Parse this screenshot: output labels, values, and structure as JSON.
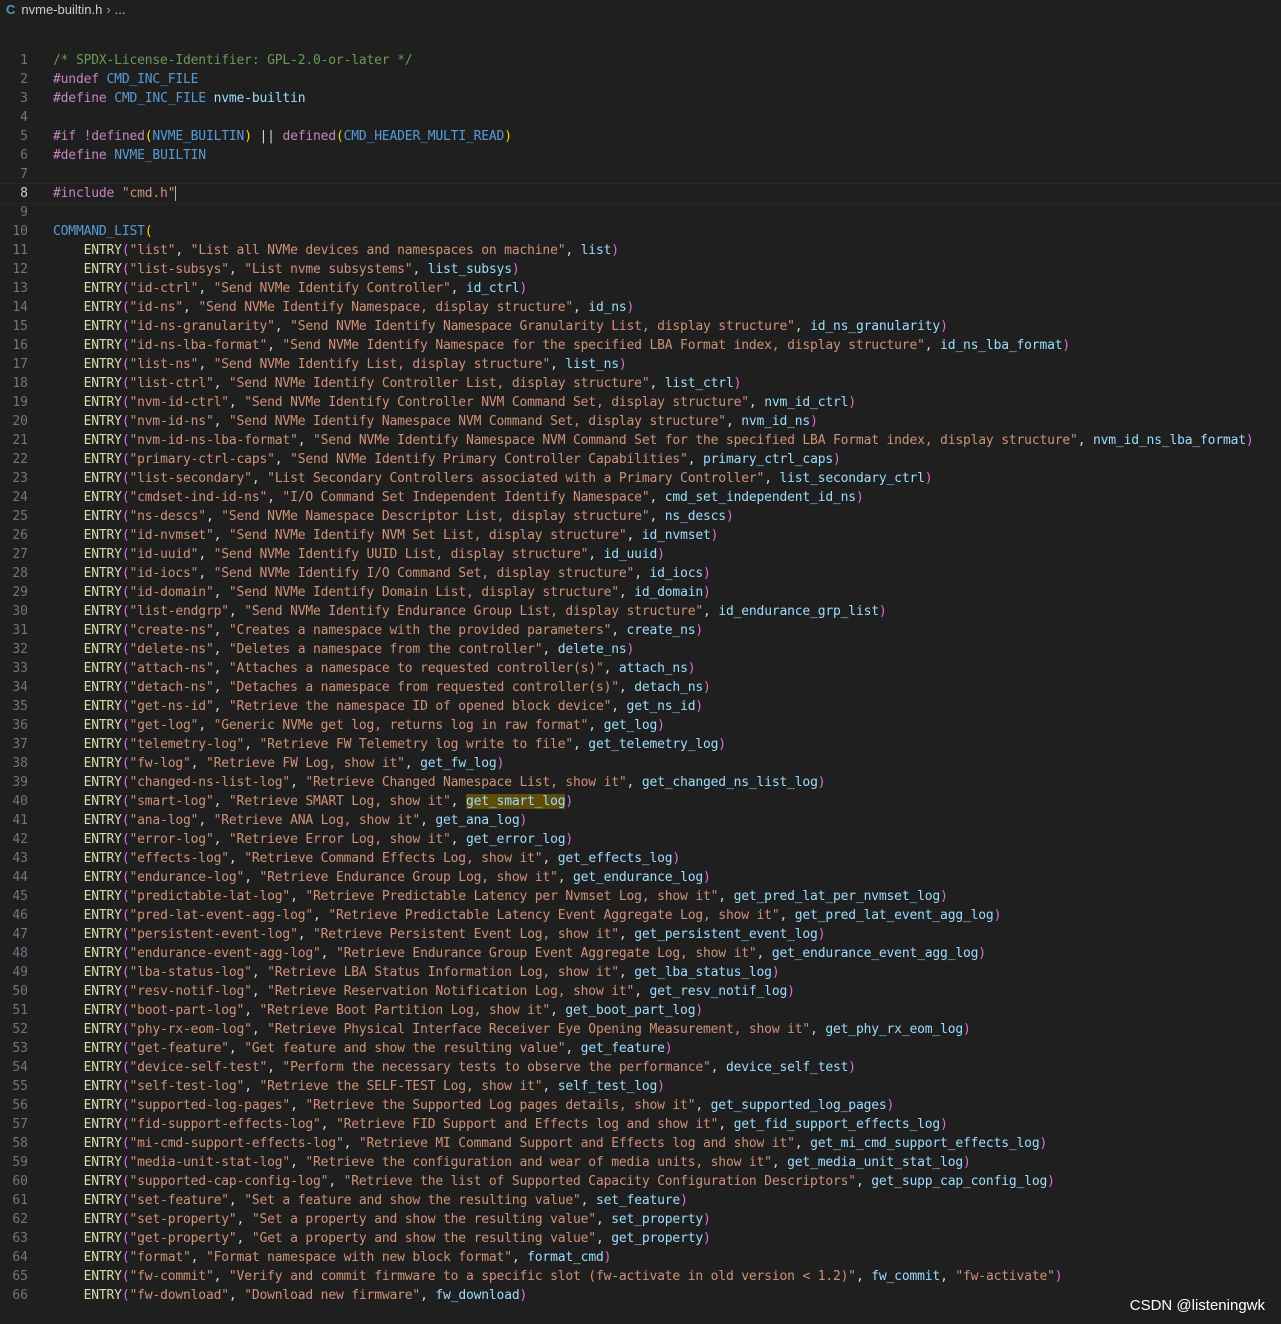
{
  "breadcrumb": {
    "file": "nvme-builtin.h",
    "more": "..."
  },
  "editor": {
    "current_line": 8,
    "highlight_line": 40,
    "highlight_word": "get_smart_log",
    "header": [
      "/* SPDX-License-Identifier: GPL-2.0-or-later */",
      "#undef CMD_INC_FILE",
      "#define CMD_INC_FILE nvme-builtin",
      "",
      "#if !defined(NVME_BUILTIN) || defined(CMD_HEADER_MULTI_READ)",
      "#define NVME_BUILTIN",
      "",
      "#include \"cmd.h\"",
      "",
      "COMMAND_LIST("
    ],
    "entries": [
      [
        "list",
        "List all NVMe devices and namespaces on machine",
        "list"
      ],
      [
        "list-subsys",
        "List nvme subsystems",
        "list_subsys"
      ],
      [
        "id-ctrl",
        "Send NVMe Identify Controller",
        "id_ctrl"
      ],
      [
        "id-ns",
        "Send NVMe Identify Namespace, display structure",
        "id_ns"
      ],
      [
        "id-ns-granularity",
        "Send NVMe Identify Namespace Granularity List, display structure",
        "id_ns_granularity"
      ],
      [
        "id-ns-lba-format",
        "Send NVMe Identify Namespace for the specified LBA Format index, display structure",
        "id_ns_lba_format"
      ],
      [
        "list-ns",
        "Send NVMe Identify List, display structure",
        "list_ns"
      ],
      [
        "list-ctrl",
        "Send NVMe Identify Controller List, display structure",
        "list_ctrl"
      ],
      [
        "nvm-id-ctrl",
        "Send NVMe Identify Controller NVM Command Set, display structure",
        "nvm_id_ctrl"
      ],
      [
        "nvm-id-ns",
        "Send NVMe Identify Namespace NVM Command Set, display structure",
        "nvm_id_ns"
      ],
      [
        "nvm-id-ns-lba-format",
        "Send NVMe Identify Namespace NVM Command Set for the specified LBA Format index, display structure",
        "nvm_id_ns_lba_format"
      ],
      [
        "primary-ctrl-caps",
        "Send NVMe Identify Primary Controller Capabilities",
        "primary_ctrl_caps"
      ],
      [
        "list-secondary",
        "List Secondary Controllers associated with a Primary Controller",
        "list_secondary_ctrl"
      ],
      [
        "cmdset-ind-id-ns",
        "I/O Command Set Independent Identify Namespace",
        "cmd_set_independent_id_ns"
      ],
      [
        "ns-descs",
        "Send NVMe Namespace Descriptor List, display structure",
        "ns_descs"
      ],
      [
        "id-nvmset",
        "Send NVMe Identify NVM Set List, display structure",
        "id_nvmset"
      ],
      [
        "id-uuid",
        "Send NVMe Identify UUID List, display structure",
        "id_uuid"
      ],
      [
        "id-iocs",
        "Send NVMe Identify I/O Command Set, display structure",
        "id_iocs"
      ],
      [
        "id-domain",
        "Send NVMe Identify Domain List, display structure",
        "id_domain"
      ],
      [
        "list-endgrp",
        "Send NVMe Identify Endurance Group List, display structure",
        "id_endurance_grp_list"
      ],
      [
        "create-ns",
        "Creates a namespace with the provided parameters",
        "create_ns"
      ],
      [
        "delete-ns",
        "Deletes a namespace from the controller",
        "delete_ns"
      ],
      [
        "attach-ns",
        "Attaches a namespace to requested controller(s)",
        "attach_ns"
      ],
      [
        "detach-ns",
        "Detaches a namespace from requested controller(s)",
        "detach_ns"
      ],
      [
        "get-ns-id",
        "Retrieve the namespace ID of opened block device",
        "get_ns_id"
      ],
      [
        "get-log",
        "Generic NVMe get log, returns log in raw format",
        "get_log"
      ],
      [
        "telemetry-log",
        "Retrieve FW Telemetry log write to file",
        "get_telemetry_log"
      ],
      [
        "fw-log",
        "Retrieve FW Log, show it",
        "get_fw_log"
      ],
      [
        "changed-ns-list-log",
        "Retrieve Changed Namespace List, show it",
        "get_changed_ns_list_log"
      ],
      [
        "smart-log",
        "Retrieve SMART Log, show it",
        "get_smart_log"
      ],
      [
        "ana-log",
        "Retrieve ANA Log, show it",
        "get_ana_log"
      ],
      [
        "error-log",
        "Retrieve Error Log, show it",
        "get_error_log"
      ],
      [
        "effects-log",
        "Retrieve Command Effects Log, show it",
        "get_effects_log"
      ],
      [
        "endurance-log",
        "Retrieve Endurance Group Log, show it",
        "get_endurance_log"
      ],
      [
        "predictable-lat-log",
        "Retrieve Predictable Latency per Nvmset Log, show it",
        "get_pred_lat_per_nvmset_log"
      ],
      [
        "pred-lat-event-agg-log",
        "Retrieve Predictable Latency Event Aggregate Log, show it",
        "get_pred_lat_event_agg_log"
      ],
      [
        "persistent-event-log",
        "Retrieve Persistent Event Log, show it",
        "get_persistent_event_log"
      ],
      [
        "endurance-event-agg-log",
        "Retrieve Endurance Group Event Aggregate Log, show it",
        "get_endurance_event_agg_log"
      ],
      [
        "lba-status-log",
        "Retrieve LBA Status Information Log, show it",
        "get_lba_status_log"
      ],
      [
        "resv-notif-log",
        "Retrieve Reservation Notification Log, show it",
        "get_resv_notif_log"
      ],
      [
        "boot-part-log",
        "Retrieve Boot Partition Log, show it",
        "get_boot_part_log"
      ],
      [
        "phy-rx-eom-log",
        "Retrieve Physical Interface Receiver Eye Opening Measurement, show it",
        "get_phy_rx_eom_log"
      ],
      [
        "get-feature",
        "Get feature and show the resulting value",
        "get_feature"
      ],
      [
        "device-self-test",
        "Perform the necessary tests to observe the performance",
        "device_self_test"
      ],
      [
        "self-test-log",
        "Retrieve the SELF-TEST Log, show it",
        "self_test_log"
      ],
      [
        "supported-log-pages",
        "Retrieve the Supported Log pages details, show it",
        "get_supported_log_pages"
      ],
      [
        "fid-support-effects-log",
        "Retrieve FID Support and Effects log and show it",
        "get_fid_support_effects_log"
      ],
      [
        "mi-cmd-support-effects-log",
        "Retrieve MI Command Support and Effects log and show it",
        "get_mi_cmd_support_effects_log"
      ],
      [
        "media-unit-stat-log",
        "Retrieve the configuration and wear of media units, show it",
        "get_media_unit_stat_log"
      ],
      [
        "supported-cap-config-log",
        "Retrieve the list of Supported Capacity Configuration Descriptors",
        "get_supp_cap_config_log"
      ],
      [
        "set-feature",
        "Set a feature and show the resulting value",
        "set_feature"
      ],
      [
        "set-property",
        "Set a property and show the resulting value",
        "set_property"
      ],
      [
        "get-property",
        "Get a property and show the resulting value",
        "get_property"
      ],
      [
        "format",
        "Format namespace with new block format",
        "format_cmd"
      ],
      [
        "fw-commit",
        "Verify and commit firmware to a specific slot (fw-activate in old version < 1.2)",
        "fw_commit",
        "fw-activate"
      ],
      [
        "fw-download",
        "Download new firmware",
        "fw_download"
      ]
    ]
  },
  "watermark": "CSDN @listeningwk",
  "colors": {
    "background": "#1f1f1f",
    "comment": "#6a9955",
    "preprocessor": "#c586c0",
    "macro": "#569cd6",
    "string": "#ce9178",
    "function": "#dcdcaa",
    "identifier": "#9cdcfe",
    "bracket_gold": "#ffd700",
    "bracket_orchid": "#da70d6",
    "word_highlight": "#614d0a"
  }
}
